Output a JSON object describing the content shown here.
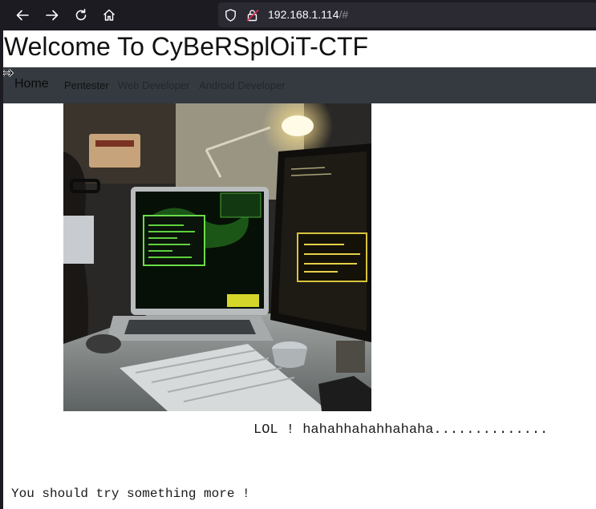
{
  "browser": {
    "url_host": "192.168.1.114",
    "url_path": "/#",
    "icons": [
      "back-arrow-icon",
      "forward-arrow-icon",
      "reload-icon",
      "home-icon",
      "shield-icon",
      "insecure-lock-icon"
    ],
    "colors": {
      "toolbar": "#1c1b22",
      "urlbar": "#2b2a33",
      "text": "#fbfbfe",
      "warning": "#e22850"
    }
  },
  "page": {
    "title": "Welcome To CyBeRSplOiT-CTF",
    "navbar": {
      "brand": "Home",
      "links": [
        "Pentester",
        "Web Developer",
        "Android Developer"
      ],
      "background": "#343a40"
    },
    "image": {
      "subject": "hacker-workstation-photo"
    },
    "lol_text": "LOL ! hahahhahahhahaha..............",
    "more_text": "You should try something more !"
  }
}
